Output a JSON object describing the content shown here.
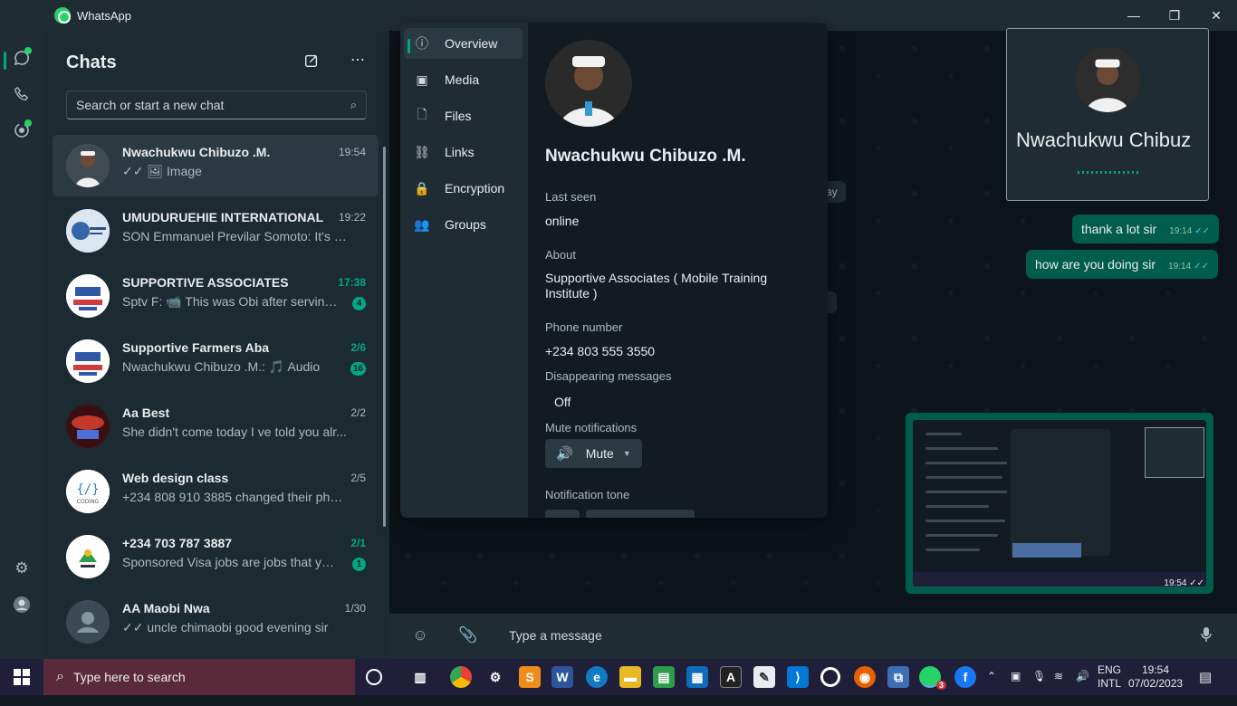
{
  "window": {
    "app_title": "WhatsApp",
    "min": "—",
    "max": "❐",
    "close": "✕"
  },
  "sidebar_rail": {
    "chats_icon": "chat-icon",
    "calls_icon": "phone-icon",
    "status_icon": "status-icon",
    "settings_icon": "gear-icon",
    "profile_icon": "avatar-icon"
  },
  "chatlist": {
    "title": "Chats",
    "new_chat_icon": "compose-icon",
    "menu_icon": "more-icon",
    "search_placeholder": "Search or start a new chat",
    "items": [
      {
        "name": "Nwachukwu Chibuzo .M.",
        "time": "19:54",
        "preview": "✓✓ 🖼 Image",
        "unread": ""
      },
      {
        "name": "UMUDURUEHIE INTERNATIONAL",
        "time": "19:22",
        "preview": "SON Emmanuel Previlar  Somoto: It's E...",
        "unread": ""
      },
      {
        "name": "SUPPORTIVE  ASSOCIATES",
        "time": "17:38",
        "preview": "Sptv F: 📹 This was Obi after serving a...",
        "unread": "4"
      },
      {
        "name": "Supportive Farmers Aba",
        "time": "2/6",
        "preview": "Nwachukwu Chibuzo .M.: 🎵 Audio",
        "unread": "16"
      },
      {
        "name": "Aa Best",
        "time": "2/2",
        "preview": "She didn't come today I ve told you alr...",
        "unread": ""
      },
      {
        "name": "Web design class",
        "time": "2/5",
        "preview": "+234 808 910 3885 changed their phon...",
        "unread": ""
      },
      {
        "name": "+234 703 787 3887",
        "time": "2/1",
        "preview": "Sponsored Visa jobs are jobs that you...",
        "unread": "1"
      },
      {
        "name": "AA Maobi Nwa",
        "time": "1/30",
        "preview": "✓✓ uncle chimaobi good evening sir",
        "unread": ""
      }
    ]
  },
  "conversation": {
    "messages": [
      {
        "text": "thank a lot sir",
        "time": "19:14",
        "ticks": "✓✓"
      },
      {
        "text": "how are you doing sir",
        "time": "19:14",
        "ticks": "✓✓"
      }
    ],
    "image_message_time": "19:54",
    "image_message_ticks": "✓✓",
    "partial_label": "ay",
    "composer": {
      "placeholder": "Type a message",
      "emoji_icon": "emoji-icon",
      "attach_icon": "paperclip-icon",
      "mic_icon": "mic-icon"
    }
  },
  "contact_info": {
    "nav": [
      {
        "icon": "ⓘ",
        "label": "Overview"
      },
      {
        "icon": "▣",
        "label": "Media"
      },
      {
        "icon": "🗋",
        "label": "Files"
      },
      {
        "icon": "⛓",
        "label": "Links"
      },
      {
        "icon": "🔒",
        "label": "Encryption"
      },
      {
        "icon": "👥",
        "label": "Groups"
      }
    ],
    "name": "Nwachukwu Chibuzo .M.",
    "last_seen_label": "Last seen",
    "last_seen_value": "online",
    "about_label": "About",
    "about_value": "Supportive Associates ( Mobile Training Institute )",
    "phone_label": "Phone number",
    "phone_value": "+234 803 555 3550",
    "disappearing_label": "Disappearing messages",
    "disappearing_value": "Off",
    "mute_label": "Mute notifications",
    "mute_button": "Mute",
    "tone_label": "Notification tone"
  },
  "call_window": {
    "name": "Nwachukwu Chibuz"
  },
  "taskbar": {
    "search_placeholder": "Type here to search",
    "whatsapp_badge": "3",
    "lang_top": "ENG",
    "lang_bottom": "INTL",
    "time": "19:54",
    "date": "07/02/2023"
  },
  "colors": {
    "accent": "#00a884",
    "bubble_out": "#005c4b",
    "bg": "#111b21",
    "panel": "#202c33"
  }
}
